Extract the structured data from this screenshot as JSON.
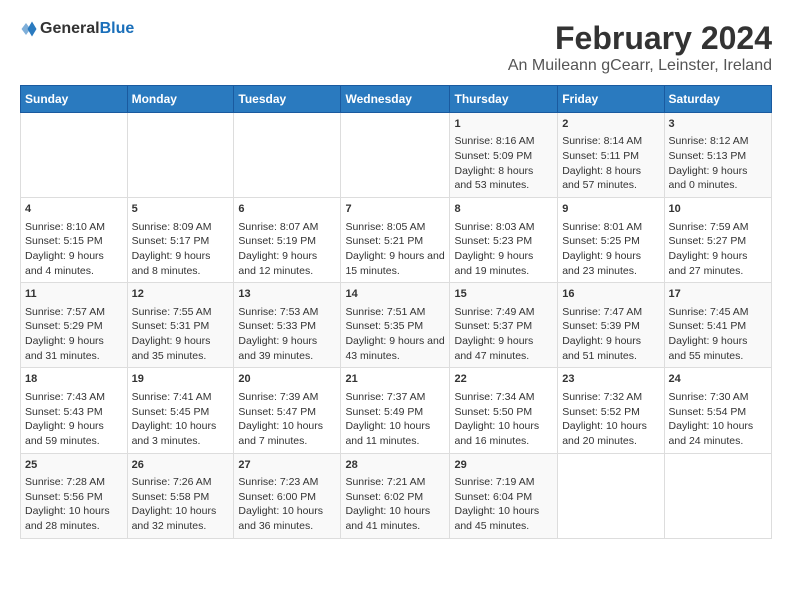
{
  "header": {
    "title": "February 2024",
    "subtitle": "An Muileann gCearr, Leinster, Ireland",
    "logo_general": "General",
    "logo_blue": "Blue"
  },
  "calendar": {
    "days_of_week": [
      "Sunday",
      "Monday",
      "Tuesday",
      "Wednesday",
      "Thursday",
      "Friday",
      "Saturday"
    ],
    "weeks": [
      [
        {
          "day": "",
          "content": ""
        },
        {
          "day": "",
          "content": ""
        },
        {
          "day": "",
          "content": ""
        },
        {
          "day": "",
          "content": ""
        },
        {
          "day": "1",
          "content": "Sunrise: 8:16 AM\nSunset: 5:09 PM\nDaylight: 8 hours and 53 minutes."
        },
        {
          "day": "2",
          "content": "Sunrise: 8:14 AM\nSunset: 5:11 PM\nDaylight: 8 hours and 57 minutes."
        },
        {
          "day": "3",
          "content": "Sunrise: 8:12 AM\nSunset: 5:13 PM\nDaylight: 9 hours and 0 minutes."
        }
      ],
      [
        {
          "day": "4",
          "content": "Sunrise: 8:10 AM\nSunset: 5:15 PM\nDaylight: 9 hours and 4 minutes."
        },
        {
          "day": "5",
          "content": "Sunrise: 8:09 AM\nSunset: 5:17 PM\nDaylight: 9 hours and 8 minutes."
        },
        {
          "day": "6",
          "content": "Sunrise: 8:07 AM\nSunset: 5:19 PM\nDaylight: 9 hours and 12 minutes."
        },
        {
          "day": "7",
          "content": "Sunrise: 8:05 AM\nSunset: 5:21 PM\nDaylight: 9 hours and 15 minutes."
        },
        {
          "day": "8",
          "content": "Sunrise: 8:03 AM\nSunset: 5:23 PM\nDaylight: 9 hours and 19 minutes."
        },
        {
          "day": "9",
          "content": "Sunrise: 8:01 AM\nSunset: 5:25 PM\nDaylight: 9 hours and 23 minutes."
        },
        {
          "day": "10",
          "content": "Sunrise: 7:59 AM\nSunset: 5:27 PM\nDaylight: 9 hours and 27 minutes."
        }
      ],
      [
        {
          "day": "11",
          "content": "Sunrise: 7:57 AM\nSunset: 5:29 PM\nDaylight: 9 hours and 31 minutes."
        },
        {
          "day": "12",
          "content": "Sunrise: 7:55 AM\nSunset: 5:31 PM\nDaylight: 9 hours and 35 minutes."
        },
        {
          "day": "13",
          "content": "Sunrise: 7:53 AM\nSunset: 5:33 PM\nDaylight: 9 hours and 39 minutes."
        },
        {
          "day": "14",
          "content": "Sunrise: 7:51 AM\nSunset: 5:35 PM\nDaylight: 9 hours and 43 minutes."
        },
        {
          "day": "15",
          "content": "Sunrise: 7:49 AM\nSunset: 5:37 PM\nDaylight: 9 hours and 47 minutes."
        },
        {
          "day": "16",
          "content": "Sunrise: 7:47 AM\nSunset: 5:39 PM\nDaylight: 9 hours and 51 minutes."
        },
        {
          "day": "17",
          "content": "Sunrise: 7:45 AM\nSunset: 5:41 PM\nDaylight: 9 hours and 55 minutes."
        }
      ],
      [
        {
          "day": "18",
          "content": "Sunrise: 7:43 AM\nSunset: 5:43 PM\nDaylight: 9 hours and 59 minutes."
        },
        {
          "day": "19",
          "content": "Sunrise: 7:41 AM\nSunset: 5:45 PM\nDaylight: 10 hours and 3 minutes."
        },
        {
          "day": "20",
          "content": "Sunrise: 7:39 AM\nSunset: 5:47 PM\nDaylight: 10 hours and 7 minutes."
        },
        {
          "day": "21",
          "content": "Sunrise: 7:37 AM\nSunset: 5:49 PM\nDaylight: 10 hours and 11 minutes."
        },
        {
          "day": "22",
          "content": "Sunrise: 7:34 AM\nSunset: 5:50 PM\nDaylight: 10 hours and 16 minutes."
        },
        {
          "day": "23",
          "content": "Sunrise: 7:32 AM\nSunset: 5:52 PM\nDaylight: 10 hours and 20 minutes."
        },
        {
          "day": "24",
          "content": "Sunrise: 7:30 AM\nSunset: 5:54 PM\nDaylight: 10 hours and 24 minutes."
        }
      ],
      [
        {
          "day": "25",
          "content": "Sunrise: 7:28 AM\nSunset: 5:56 PM\nDaylight: 10 hours and 28 minutes."
        },
        {
          "day": "26",
          "content": "Sunrise: 7:26 AM\nSunset: 5:58 PM\nDaylight: 10 hours and 32 minutes."
        },
        {
          "day": "27",
          "content": "Sunrise: 7:23 AM\nSunset: 6:00 PM\nDaylight: 10 hours and 36 minutes."
        },
        {
          "day": "28",
          "content": "Sunrise: 7:21 AM\nSunset: 6:02 PM\nDaylight: 10 hours and 41 minutes."
        },
        {
          "day": "29",
          "content": "Sunrise: 7:19 AM\nSunset: 6:04 PM\nDaylight: 10 hours and 45 minutes."
        },
        {
          "day": "",
          "content": ""
        },
        {
          "day": "",
          "content": ""
        }
      ]
    ]
  }
}
